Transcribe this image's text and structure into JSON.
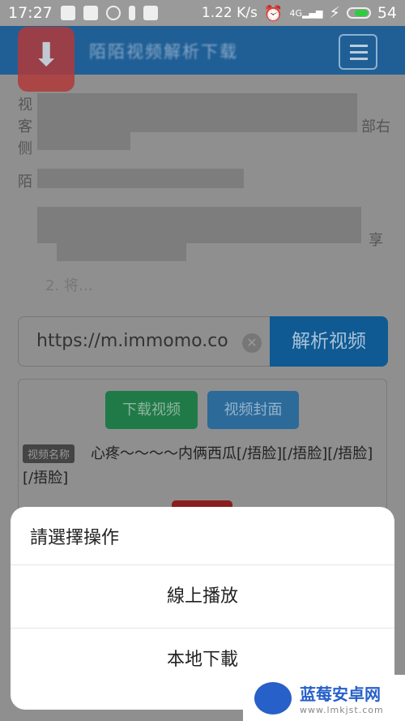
{
  "status_bar": {
    "time": "17:27",
    "speed": "1.22 K/s",
    "network": "4G",
    "battery": "54"
  },
  "navbar": {
    "title": "陌陌视频解析下载",
    "logo_icon": "download-arrow-icon",
    "menu_icon": "hamburger-icon"
  },
  "obscured_text": {
    "line1_start": "视",
    "line2_start": "客",
    "line2_end": "部右",
    "line3_start": "侧",
    "line4_start": "陌",
    "line5_end": "享",
    "step2": "2. 将…"
  },
  "form": {
    "url_value": "https://m.immomo.co",
    "parse_button": "解析视频"
  },
  "result": {
    "download_button": "下载视频",
    "cover_button": "视频封面",
    "name_tag": "视频名称",
    "video_name": "心疼～～～～内俩西瓜[/捂脸][/捂脸][/捂脸][/捂脸]"
  },
  "action_sheet": {
    "title": "請選擇操作",
    "options": [
      "線上播放",
      "本地下載"
    ]
  },
  "watermark": {
    "name": "蓝莓安卓网",
    "url": "www.lmkjst.com"
  },
  "colors": {
    "navbar": "#1f5f95",
    "primary": "#0f5a92",
    "success": "#1f7a48",
    "overlay": "#8f8f8f"
  }
}
